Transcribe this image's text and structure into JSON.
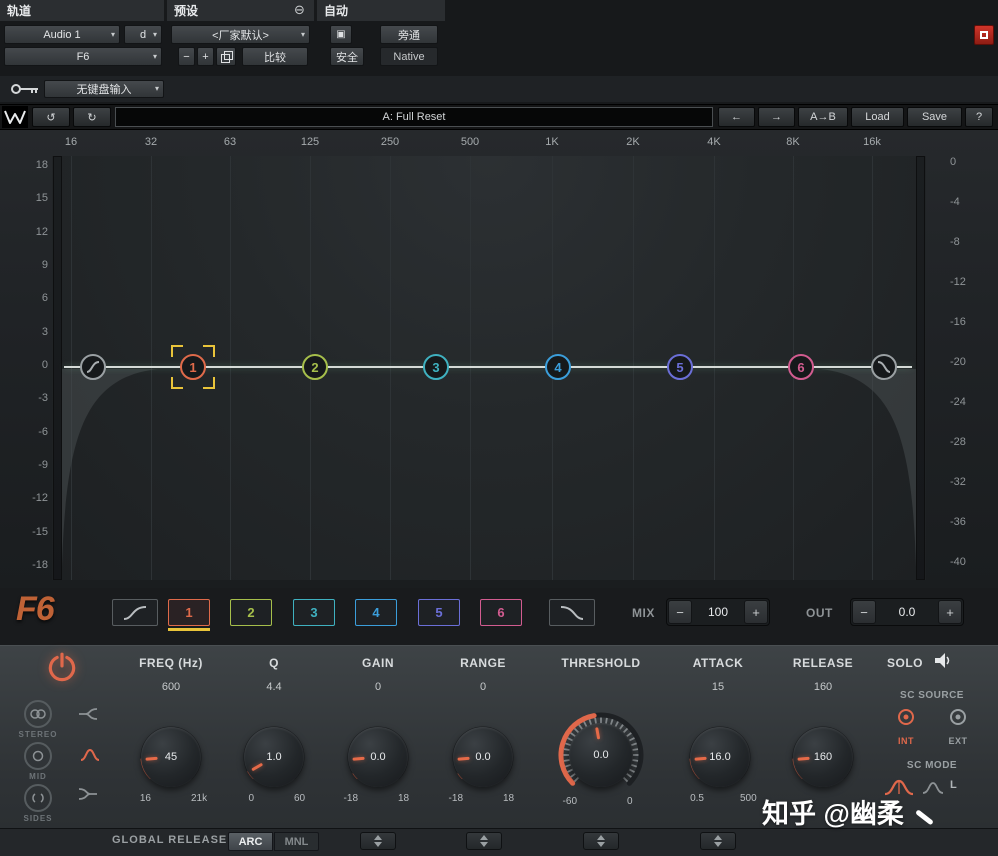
{
  "colors": {
    "accent_orange": "#e0684b",
    "selection_yellow": "#e9c43a",
    "band_colors": [
      "#df6a4a",
      "#a6bf4b",
      "#3fb1c0",
      "#3b9edb",
      "#6b6fd8",
      "#d25c90"
    ],
    "red_activate": "#c03022"
  },
  "icons": {
    "dropdown": "▾",
    "minus": "−",
    "plus": "+",
    "preset_menu": "⊖",
    "auto_box": "▣",
    "undo": "↺",
    "redo": "↻",
    "back": "←",
    "forward": "→"
  },
  "host": {
    "track_label": "轨道",
    "channel": "Audio 1",
    "d_button": "d",
    "plugin_name": "F6",
    "preset_label": "预设",
    "preset_value": "<厂家默认>",
    "compare_button": "比较",
    "auto_label": "自动",
    "bypass_button": "旁通",
    "safe_button": "安全",
    "native_button": "Native",
    "keyboard_value": "无键盘输入"
  },
  "toolbar": {
    "preset_display": "A: Full Reset",
    "ab_button": "A→B",
    "load_button": "Load",
    "save_button": "Save",
    "help_button": "?"
  },
  "eq": {
    "freq_labels": [
      "16",
      "32",
      "63",
      "125",
      "250",
      "500",
      "1K",
      "2K",
      "4K",
      "8K",
      "16k"
    ],
    "db_left": [
      "18",
      "15",
      "12",
      "9",
      "6",
      "3",
      "0",
      "-3",
      "-6",
      "-9",
      "-12",
      "-15",
      "-18"
    ],
    "db_right": [
      "0",
      "-4",
      "-8",
      "-12",
      "-16",
      "-20",
      "-24",
      "-28",
      "-32",
      "-36",
      "-40"
    ],
    "bands": [
      {
        "num": "1"
      },
      {
        "num": "2"
      },
      {
        "num": "3"
      },
      {
        "num": "4"
      },
      {
        "num": "5"
      },
      {
        "num": "6"
      }
    ]
  },
  "band_bar": {
    "logo": "F6",
    "mix_label": "MIX",
    "mix_value": "100",
    "out_label": "OUT",
    "out_value": "0.0"
  },
  "controls": {
    "knobs": [
      {
        "label": "FREQ (Hz)",
        "readout": "600",
        "value": "45",
        "min": "16",
        "max": "21k"
      },
      {
        "label": "Q",
        "readout": "4.4",
        "value": "1.0",
        "min": "0",
        "max": "60"
      },
      {
        "label": "GAIN",
        "readout": "0",
        "value": "0.0",
        "min": "-18",
        "max": "18"
      },
      {
        "label": "RANGE",
        "readout": "0",
        "value": "0.0",
        "min": "-18",
        "max": "18"
      },
      {
        "label": "THRESHOLD",
        "readout": "",
        "value": "0.0",
        "min": "-60",
        "max": "0"
      },
      {
        "label": "ATTACK",
        "readout": "15",
        "value": "16.0",
        "min": "0.5",
        "max": "500"
      },
      {
        "label": "RELEASE",
        "readout": "160",
        "value": "160",
        "min": "",
        "max": ""
      }
    ],
    "solo_label": "SOLO",
    "sc_source_label": "SC SOURCE",
    "int_label": "INT",
    "ext_label": "EXT",
    "sc_mode_label": "SC MODE",
    "sc_mode_l": "L",
    "stereo_label": "STEREO",
    "mid_label": "MID",
    "sides_label": "SIDES",
    "global_release_label": "GLOBAL RELEASE",
    "arc_button": "ARC",
    "mnl_button": "MNL"
  },
  "watermark": "知乎 @幽柔"
}
